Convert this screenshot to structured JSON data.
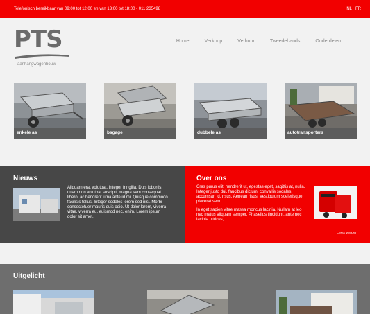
{
  "topbar": {
    "contact": "Telefonisch bereikbaar van 09:00 tot 12:00 en van 13:00 tot 18:00 - 011 235498",
    "languages": [
      "NL",
      "FR"
    ]
  },
  "brand": {
    "logo_text": "PTS",
    "tagline": "aanhangwagenbouw"
  },
  "nav": {
    "items": [
      "Home",
      "Verkoop",
      "Verhuur",
      "Tweedehands",
      "Onderdelen"
    ]
  },
  "categories": [
    {
      "label": "enkele as"
    },
    {
      "label": "bagage"
    },
    {
      "label": "dubbele as"
    },
    {
      "label": "autotransporters"
    }
  ],
  "news": {
    "title": "Nieuws",
    "text": "Aliquam erat volutpat. Integer fringilla. Duis lobortis, quam non volutpat suscipit, magna sem consequat libero, ac hendrerit urna ante id mi. Quisque commodo facilisis tellus. Integer sodales lorem sed nisl. Morbi consectetuer mauris quis odio. Ut dolor lorem, viverra vitae, viverra eu, euismod nec, enim. Lorem ipsum dolor sit amet,"
  },
  "about": {
    "title": "Over ons",
    "paragraph1": "Cras purus elit, hendrerit ut, egestas eget, sagittis at, nulla. Integer justo dui, faucibus dictum, convallis sodales, accumsan id, risus. Aenean risus. Vestibulum scelerisque placerat sem.",
    "paragraph2": "In eget sapien vitae massa rhoncus lacinia. Nullam at leo nec metus aliquam semper. Phasellus tincidunt, ante nec lacinia ultrices,",
    "read_more": "Lees verder"
  },
  "featured": {
    "title": "Uitgelicht"
  },
  "colors": {
    "brand_red": "#f20000",
    "dark_panel": "#474747",
    "featured_panel": "#6e6e6e",
    "background": "#f2f2f2"
  }
}
